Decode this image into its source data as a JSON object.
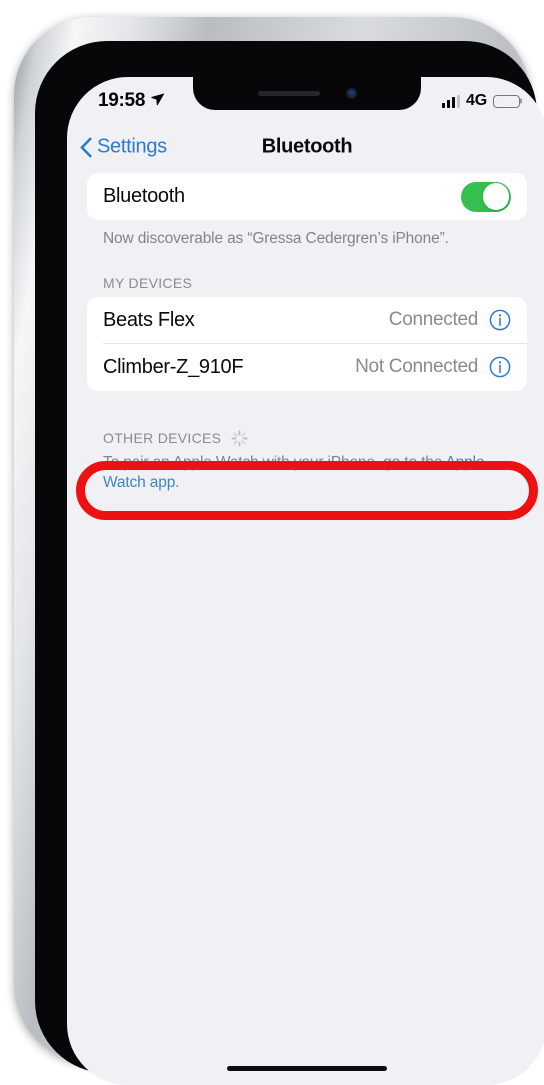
{
  "status_bar": {
    "time": "19:58",
    "location_icon": "location-arrow-icon",
    "signal_icon": "cellular-signal-icon",
    "network": "4G",
    "battery_icon": "battery-full-icon"
  },
  "nav": {
    "back_label": "Settings",
    "back_icon": "chevron-left-icon",
    "title": "Bluetooth"
  },
  "bluetooth": {
    "label": "Bluetooth",
    "toggle_state": "on",
    "toggle_color": "#34bf4e",
    "discoverable_note": "Now discoverable as “Gressa Cedergren’s iPhone”."
  },
  "my_devices": {
    "header": "MY DEVICES",
    "items": [
      {
        "name": "Beats Flex",
        "status": "Connected",
        "info_icon": "info-circle-icon",
        "highlighted": true
      },
      {
        "name": "Climber-Z_910F",
        "status": "Not Connected",
        "info_icon": "info-circle-icon",
        "highlighted": false
      }
    ]
  },
  "other_devices": {
    "header": "OTHER DEVICES",
    "spinner_icon": "activity-spinner-icon",
    "note_prefix": "To pair an Apple Watch with your iPhone, go to the ",
    "note_link": "Apple Watch app",
    "note_suffix": "."
  },
  "annotation": {
    "shape": "oval",
    "color": "#ee1111",
    "targets": "Beats Flex row"
  },
  "colors": {
    "screen_background": "#f1f1f5",
    "card_background": "#ffffff",
    "accent_blue": "#2b7ad1",
    "link_blue": "#3d86c6",
    "secondary_text": "#8a8a8f"
  },
  "home_indicator": "home-indicator-bar"
}
